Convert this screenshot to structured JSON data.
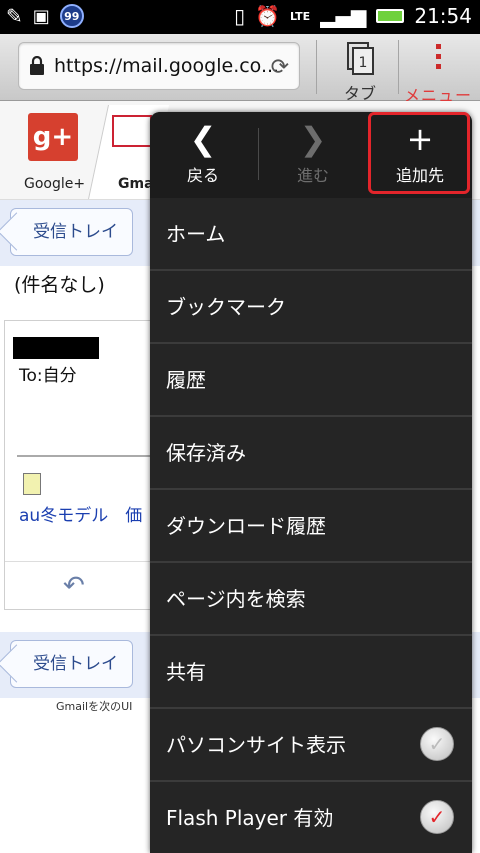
{
  "status_bar": {
    "notification_count": "99",
    "network": "LTE",
    "time": "21:54"
  },
  "browser": {
    "url": "https://mail.google.co...",
    "tabs_count": "1",
    "tabs_label": "タブ",
    "menu_label": "メニュー"
  },
  "page": {
    "apps": [
      {
        "label": "Google+",
        "icon": "g+"
      },
      {
        "label": "Gmai",
        "icon": "gmail-icon"
      }
    ],
    "inbox_button_top": "受信トレイ",
    "subject": "(件名なし)",
    "to_line": "To:自分",
    "attachment_link": "au冬モデル　価",
    "inbox_button_bottom": "受信トレイ",
    "footer": "Gmailを次のUI"
  },
  "menu": {
    "nav": [
      {
        "arrow": "<",
        "label": "戻る"
      },
      {
        "arrow": ">",
        "label": "進む"
      },
      {
        "arrow": "+",
        "label": "追加先"
      }
    ],
    "items": [
      {
        "label": "ホーム"
      },
      {
        "label": "ブックマーク"
      },
      {
        "label": "履歴"
      },
      {
        "label": "保存済み"
      },
      {
        "label": "ダウンロード履歴"
      },
      {
        "label": "ページ内を検索"
      },
      {
        "label": "共有"
      },
      {
        "label": "パソコンサイト表示",
        "checked": false
      },
      {
        "label": "Flash Player 有効",
        "checked": true
      }
    ],
    "highlight_color": "#e3252b"
  }
}
